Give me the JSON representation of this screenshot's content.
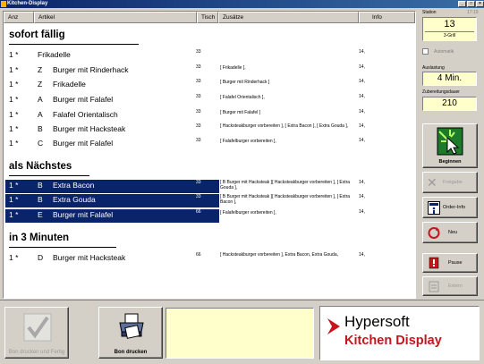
{
  "window": {
    "title": "Kitchen-Display"
  },
  "columns": {
    "anz": "Anz",
    "artikel": "Artikel",
    "tisch": "Tisch",
    "zusaetze": "Zusätze",
    "info": "Info"
  },
  "sections": [
    {
      "title": "sofort fällig"
    },
    {
      "title": "als Nächstes"
    },
    {
      "title": "in  3 Minuten"
    }
  ],
  "rows": [
    {
      "anz": "1 *",
      "grp": "",
      "artikel": "Frikadelle",
      "tisch": "33",
      "zusaetze": "",
      "info": "14,"
    },
    {
      "anz": "1 *",
      "grp": "Z",
      "artikel": "Burger mit Rinderhack",
      "tisch": "33",
      "zusaetze": "[ Frikadelle ],",
      "info": "14,"
    },
    {
      "anz": "1 *",
      "grp": "Z",
      "artikel": "Frikadelle",
      "tisch": "33",
      "zusaetze": "[ Burger mit Rinderhack ]",
      "info": "14,"
    },
    {
      "anz": "1 *",
      "grp": "A",
      "artikel": "Burger mit Falafel",
      "tisch": "33",
      "zusaetze": "[ Falafel Orientalisch ],",
      "info": "14,"
    },
    {
      "anz": "1 *",
      "grp": "A",
      "artikel": "Falafel Orientalisch",
      "tisch": "33",
      "zusaetze": "[ Burger mit Falafel ]",
      "info": "14,"
    },
    {
      "anz": "1 *",
      "grp": "B",
      "artikel": "Burger mit Hacksteak",
      "tisch": "33",
      "zusaetze": "[ Hacksteakburger vorbereiten ], [ Extra Bacon ], [ Extra Gouda ],",
      "info": "14,"
    },
    {
      "anz": "1 *",
      "grp": "C",
      "artikel": "Burger mit Falafel",
      "tisch": "33",
      "zusaetze": "[ Falafelburger vorbereiten ],",
      "info": "14,"
    },
    {
      "anz": "1 *",
      "grp": "B",
      "artikel": "Extra Bacon",
      "tisch": "33",
      "zusaetze": "[ B  Burger mit Hacksteak ][ Hacksteakburger vorbereiten ], [ Extra Gouda ],",
      "info": "14,"
    },
    {
      "anz": "1 *",
      "grp": "B",
      "artikel": "Extra Gouda",
      "tisch": "33",
      "zusaetze": "[ B  Burger mit Hacksteak ][ Hacksteakburger vorbereiten ], [ Extra Bacon ],",
      "info": "14,"
    },
    {
      "anz": "1 *",
      "grp": "E",
      "artikel": "Burger mit Falafel",
      "tisch": "66",
      "zusaetze": "[ Falafelburger vorbereiten ],",
      "info": "14,"
    },
    {
      "anz": "1 *",
      "grp": "D",
      "artikel": "Burger mit Hacksteak",
      "tisch": "66",
      "zusaetze": "[ Hacksteakburger vorbereiten ], Extra Bacon, Extra Gouda,",
      "info": "14,"
    }
  ],
  "right": {
    "station_label": "Station",
    "station_time": "17:19",
    "station_value": "13",
    "station_sub": "3-Grill",
    "auto_label": "Automatik",
    "auslastung_label": "Auslastung",
    "auslastung_value": "4 Min.",
    "zub_label": "Zubereitungsdauer",
    "zub_value": "210",
    "beginnen": "Beginnen",
    "freigabe": "Freigabe",
    "orderinfo": "Order-Info",
    "neu": "Neu",
    "pause": "Pause",
    "extern": "Extern"
  },
  "bottom": {
    "bon_fertig": "Bon drucken und Fertig",
    "bon_drucken": "Bon drucken"
  },
  "logo": {
    "brand": "Hypersoft",
    "product": "Kitchen Display"
  },
  "colors": {
    "highlight": "#0a246a",
    "logo_red": "#c4161c",
    "yellow_box": "#ffffcc"
  }
}
